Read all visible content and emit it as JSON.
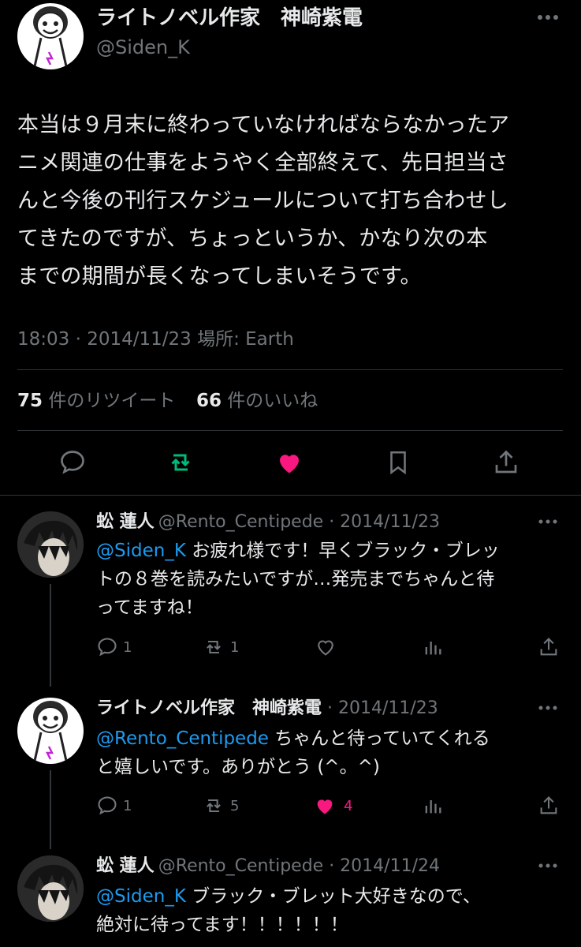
{
  "main": {
    "display_name": "ライトノベル作家　神崎紫電",
    "handle": "@Siden_K",
    "text_lines": [
      "本当は９月末に終わっていなければならなかったア",
      "ニメ関連の仕事をようやく全部終えて、先日担当さ",
      "んと今後の刊行スケジュールについて打ち合わせし",
      "てきたのですが、ちょっというか、かなり次の本",
      "までの期間が長くなってしまいそうです。"
    ],
    "timestamp": "18:03 · 2014/11/23 場所: Earth",
    "retweet_count": "75",
    "retweet_label": "件のリツイート",
    "like_count": "66",
    "like_label": "件のいいね"
  },
  "replies": [
    {
      "name": "蚣 蓮人",
      "meta": "@Rento_Centipede · 2014/11/23",
      "mention": "@Siden_K",
      "line1": " お疲れ様です！早くブラック・ブレッ",
      "line2": "トの８巻を読みたいですが…発売までちゃんと待",
      "line3": "ってますね！",
      "replies": "1",
      "retweets": "1",
      "likes": ""
    },
    {
      "name": "ライトノベル作家　神崎紫電",
      "meta": " · 2014/11/23",
      "mention": "@Rento_Centipede",
      "line1": " ちゃんと待っていてくれる",
      "line2": "と嬉しいです。ありがとう (^。^)",
      "replies": "1",
      "retweets": "5",
      "likes": "4"
    },
    {
      "name": "蚣 蓮人",
      "meta": "@Rento_Centipede · 2014/11/24",
      "mention": "@Siden_K",
      "line1": " ブラック・ブレット大好きなので、",
      "line2": "絶対に待ってます！！！！！！"
    }
  ],
  "colors": {
    "background": "#000000",
    "text": "#e7e9ea",
    "muted": "#71767b",
    "link": "#1d9bf0",
    "retweet_active": "#00ba7c",
    "like_active": "#f91880"
  }
}
